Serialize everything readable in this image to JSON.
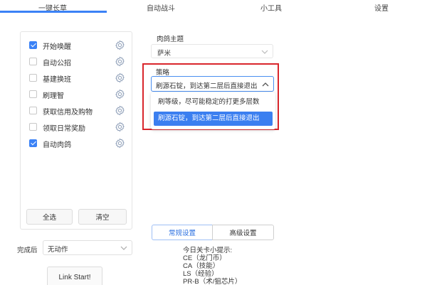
{
  "tabs": [
    {
      "label": "一键长草",
      "active": true
    },
    {
      "label": "自动战斗",
      "active": false
    },
    {
      "label": "小工具",
      "active": false
    },
    {
      "label": "设置",
      "active": false
    }
  ],
  "tasks": [
    {
      "label": "开始唤醒",
      "checked": true
    },
    {
      "label": "自动公招",
      "checked": false
    },
    {
      "label": "基建换班",
      "checked": false
    },
    {
      "label": "刷理智",
      "checked": false
    },
    {
      "label": "获取信用及购物",
      "checked": false
    },
    {
      "label": "领取日常奖励",
      "checked": false
    },
    {
      "label": "自动肉鸽",
      "checked": true
    }
  ],
  "task_buttons": {
    "select_all": "全选",
    "clear": "清空"
  },
  "after_completion": {
    "label": "完成后",
    "value": "无动作"
  },
  "link_start": "Link Start!",
  "roguelike": {
    "theme_label": "肉鸽主题",
    "theme_value": "萨米",
    "strategy_label": "策略",
    "strategy_value": "刷源石锭，到达第二层后直接退出",
    "strategy_options": [
      {
        "label": "刷等级，尽可能稳定的打更多层数",
        "selected": false
      },
      {
        "label": "刷源石锭，到达第二层后直接退出",
        "selected": true
      }
    ]
  },
  "settings_tabs": {
    "normal": "常规设置",
    "advanced": "高级设置"
  },
  "tips": [
    "今日关卡小提示:",
    "CE（龙门币）",
    "CA（技能）",
    "LS（经验）",
    "PR-B（术/狙芯片）"
  ],
  "colors": {
    "accent": "#3b82f6",
    "highlight": "#d9262c"
  }
}
